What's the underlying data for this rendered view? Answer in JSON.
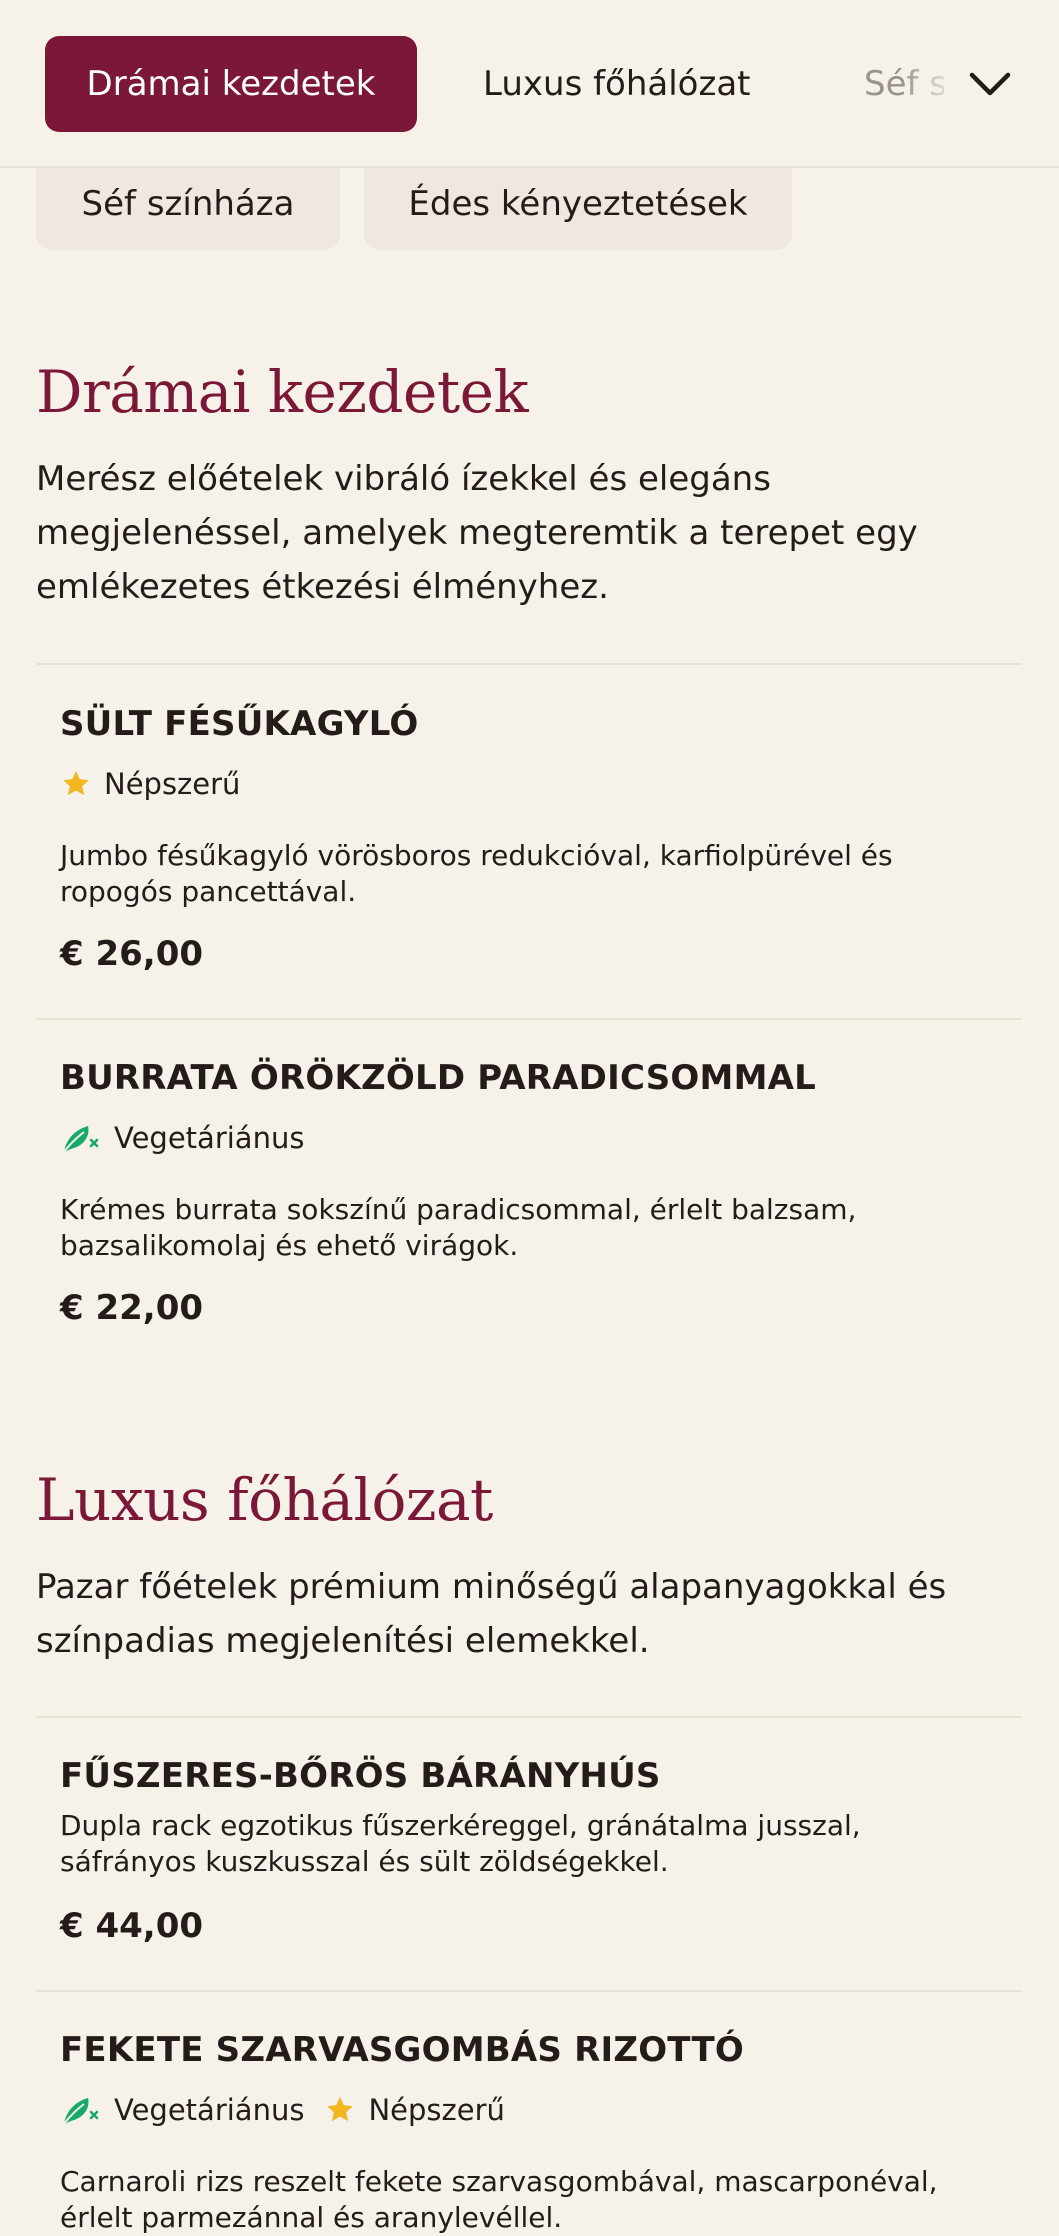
{
  "nav": {
    "tabs": [
      {
        "label": "Drámai kezdetek",
        "active": true
      },
      {
        "label": "Luxus főhálózat",
        "active": false
      },
      {
        "label": "Séf színháza",
        "active": false
      }
    ],
    "overflow_chips": [
      {
        "label": "Séf színháza"
      },
      {
        "label": "Édes kényeztetések"
      }
    ],
    "expand_icon": "chevron-down-icon"
  },
  "colors": {
    "accent": "#7b1737",
    "background": "#f6f2ea",
    "chip": "#efe8e0",
    "star": "#f2b61f",
    "veg": "#17a86b"
  },
  "sections": [
    {
      "title": "Drámai kezdetek",
      "description": "Merész előételek vibráló ízekkel és elegáns megjelenéssel, amelyek megteremtik a terepet egy emlékezetes étkezési élményhez.",
      "items": [
        {
          "name": "SÜLT FÉSŰKAGYLÓ",
          "tags": [
            {
              "label": "Népszerű",
              "icon": "star-icon"
            }
          ],
          "description": "Jumbo fésűkagyló vörösboros redukcióval, karfiolpürével és ropogós pancettával.",
          "price": "€ 26,00"
        },
        {
          "name": "BURRATA ÖRÖKZÖLD PARADICSOMMAL",
          "tags": [
            {
              "label": "Vegetáriánus",
              "icon": "leaf-icon"
            }
          ],
          "description": "Krémes burrata sokszínű paradicsommal, érlelt balzsam, bazsalikomolaj és ehető virágok.",
          "price": "€ 22,00"
        }
      ]
    },
    {
      "title": "Luxus főhálózat",
      "description": "Pazar főételek prémium minőségű alapanyagokkal és színpadias megjelenítési elemekkel.",
      "items": [
        {
          "name": "FŰSZERES-BŐRÖS BÁRÁNYHÚS",
          "tags": [],
          "description": "Dupla rack egzotikus fűszerkéreggel, gránátalma jusszal, sáfrányos kuszkusszal és sült zöldségekkel.",
          "price": "€ 44,00"
        },
        {
          "name": "FEKETE SZARVASGOMBÁS RIZOTTÓ",
          "tags": [
            {
              "label": "Vegetáriánus",
              "icon": "leaf-icon"
            },
            {
              "label": "Népszerű",
              "icon": "star-icon"
            }
          ],
          "description": "Carnaroli rizs reszelt fekete szarvasgombával, mascarponéval, érlelt parmezánnal és aranylevéllel.",
          "price": ""
        }
      ]
    }
  ]
}
